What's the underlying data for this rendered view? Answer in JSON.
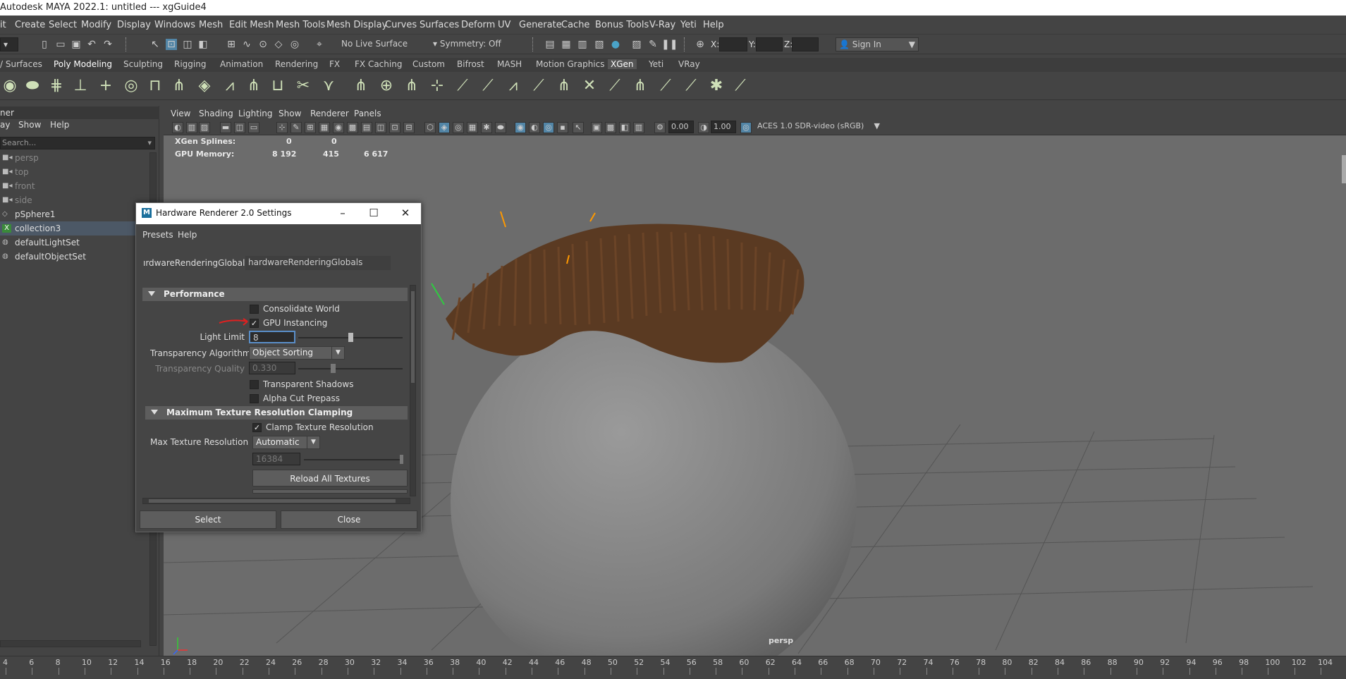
{
  "window": {
    "title": "Autodesk MAYA 2022.1: untitled   ---   xgGuide4"
  },
  "menubar": [
    "it",
    "Create",
    "Select",
    "Modify",
    "Display",
    "Windows",
    "Mesh",
    "Edit Mesh",
    "Mesh Tools",
    "Mesh Display",
    "Curves",
    "Surfaces",
    "Deform",
    "UV",
    "Generate",
    "Cache",
    "Bonus Tools",
    "V-Ray",
    "Yeti",
    "Help"
  ],
  "statusline": {
    "live_surface": "No Live Surface",
    "symmetry": "Symmetry: Off",
    "x_label": "X:",
    "y_label": "Y:",
    "z_label": "Z:",
    "sign_in": "Sign In"
  },
  "shelf_tabs": [
    "/ Surfaces",
    "Poly Modeling",
    "Sculpting",
    "Rigging",
    "Animation",
    "Rendering",
    "FX",
    "FX Caching",
    "Custom",
    "Bifrost",
    "MASH",
    "Motion Graphics",
    "XGen",
    "Yeti",
    "VRay"
  ],
  "shelf_active_tab": "XGen",
  "outliner": {
    "header": "ner",
    "menu": [
      "ay",
      "Show",
      "Help"
    ],
    "search_placeholder": "Search...",
    "items": [
      {
        "label": "persp",
        "icon": "camera-icon",
        "dim": true
      },
      {
        "label": "top",
        "icon": "camera-icon",
        "dim": true
      },
      {
        "label": "front",
        "icon": "camera-icon",
        "dim": true
      },
      {
        "label": "side",
        "icon": "camera-icon",
        "dim": true
      },
      {
        "label": "pSphere1",
        "icon": "mesh-icon",
        "dim": false
      },
      {
        "label": "collection3",
        "icon": "xgen-collection-icon",
        "dim": false,
        "selected": true
      },
      {
        "label": "defaultLightSet",
        "icon": "set-icon",
        "dim": false
      },
      {
        "label": "defaultObjectSet",
        "icon": "set-icon",
        "dim": false
      }
    ]
  },
  "viewport": {
    "menu": [
      "View",
      "Shading",
      "Lighting",
      "Show",
      "Renderer",
      "Panels"
    ],
    "exposure": "0.00",
    "gamma": "1.00",
    "color_space": "ACES 1.0 SDR-video (sRGB)",
    "hud": {
      "row1": {
        "label": "XGen Splines:",
        "v1": "0",
        "v2": "0"
      },
      "row2": {
        "label": "GPU Memory:",
        "v1": "8 192",
        "v2": "415",
        "v3": "6 617"
      }
    },
    "camera_label": "persp"
  },
  "dialog": {
    "title": "Hardware Renderer 2.0 Settings",
    "menu": [
      "Presets",
      "Help"
    ],
    "node_label": "ırdwareRenderingGlobals:",
    "node_value": "hardwareRenderingGlobals",
    "performance": {
      "header": "Performance",
      "consolidate_world": {
        "label": "Consolidate World",
        "checked": false
      },
      "gpu_instancing": {
        "label": "GPU Instancing",
        "checked": true
      },
      "light_limit": {
        "label": "Light Limit",
        "value": "8",
        "fraction": 0.5
      },
      "transparency_algorithm": {
        "label": "Transparency Algorithm",
        "value": "Object Sorting"
      },
      "transparency_quality": {
        "label": "Transparency Quality",
        "value": "0.330",
        "fraction": 0.33
      },
      "transparent_shadows": {
        "label": "Transparent Shadows",
        "checked": false
      },
      "alpha_cut_prepass": {
        "label": "Alpha Cut Prepass",
        "checked": false
      }
    },
    "texture": {
      "header": "Maximum Texture Resolution Clamping",
      "clamp": {
        "label": "Clamp Texture Resolution",
        "checked": true
      },
      "max_res": {
        "label": "Max Texture Resolution",
        "value": "Automatic"
      },
      "size_value": "16384",
      "reload_button": "Reload All Textures"
    },
    "buttons": {
      "select": "Select",
      "close": "Close"
    }
  },
  "timeline": {
    "ticks": [
      "4",
      "6",
      "8",
      "10",
      "12",
      "14",
      "16",
      "18",
      "20",
      "22",
      "24",
      "26",
      "28",
      "30",
      "32",
      "34",
      "36",
      "38",
      "40",
      "42",
      "44",
      "46",
      "48",
      "50",
      "52",
      "54",
      "56",
      "58",
      "60",
      "62",
      "64",
      "66",
      "68",
      "70",
      "72",
      "74",
      "76",
      "78",
      "80",
      "82",
      "84",
      "86",
      "88",
      "90",
      "92",
      "94",
      "96",
      "98",
      "100",
      "102",
      "104"
    ]
  }
}
